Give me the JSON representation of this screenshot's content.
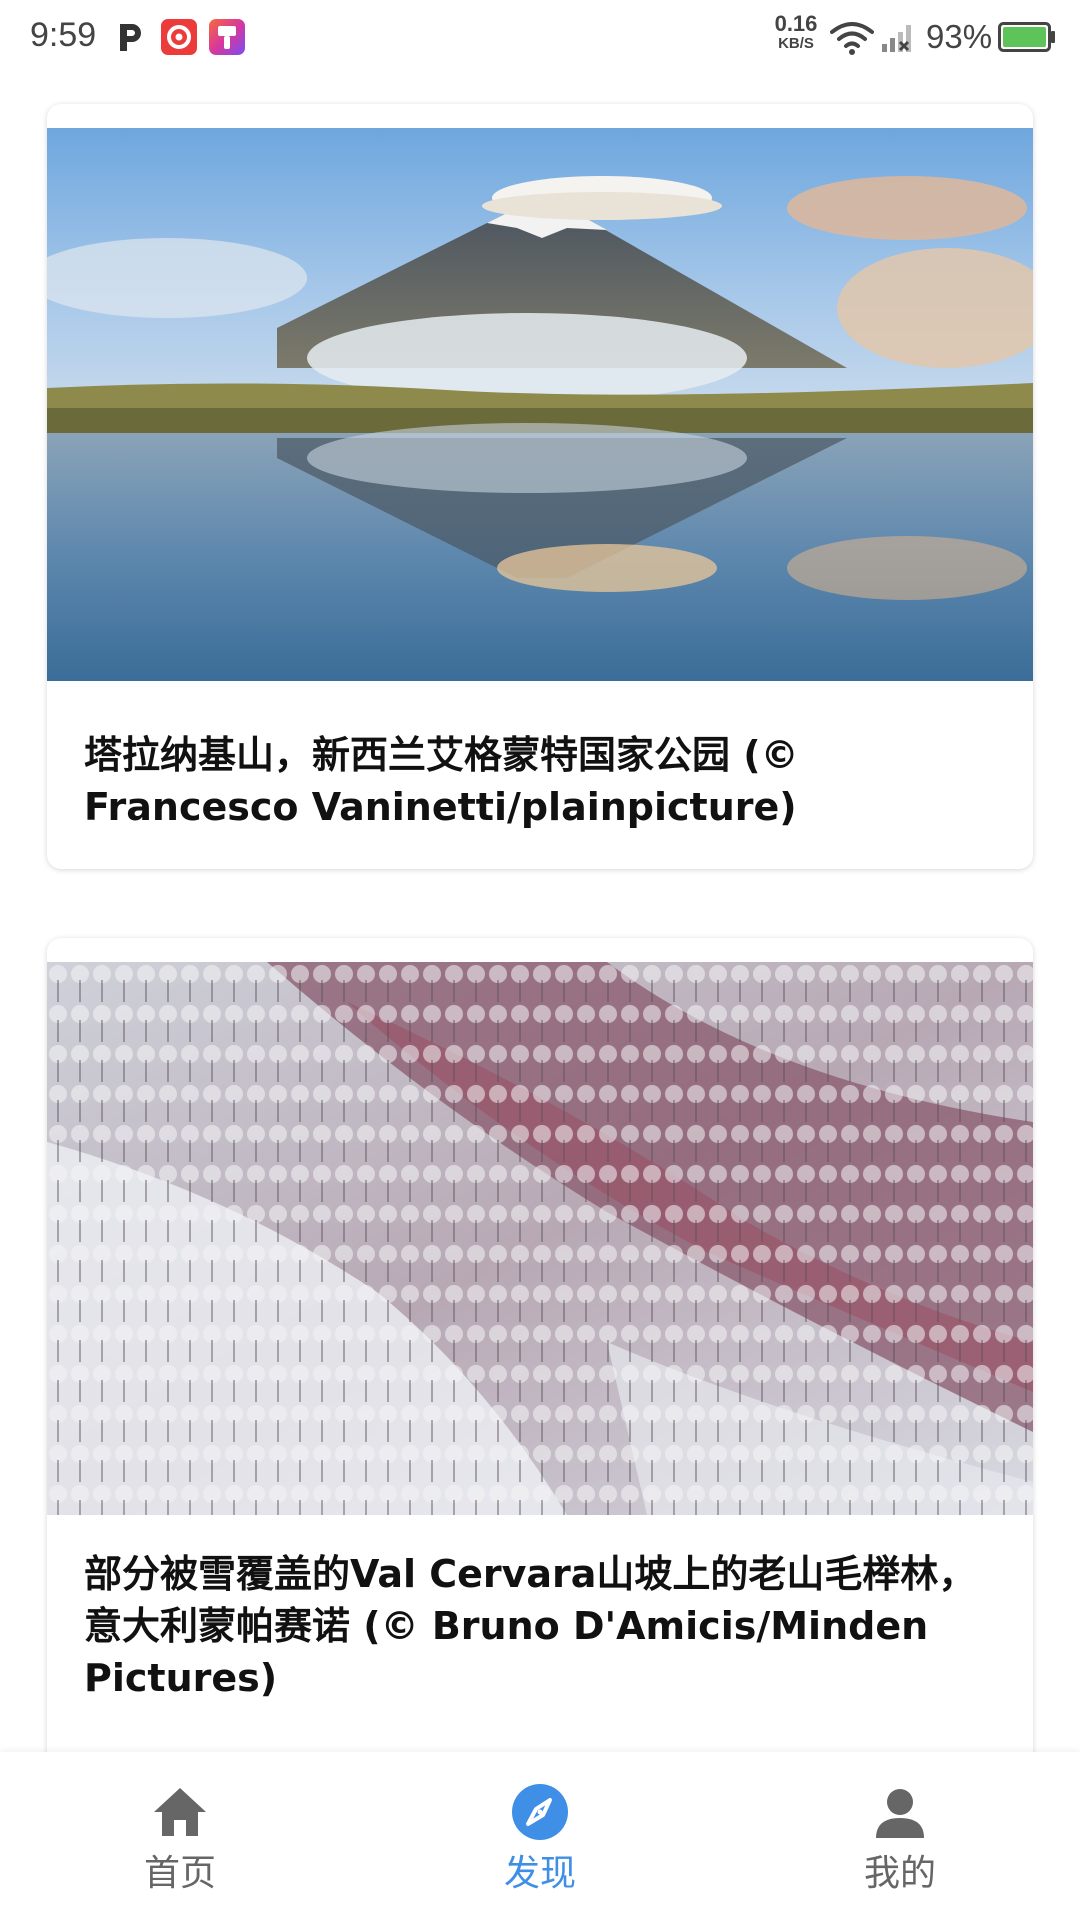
{
  "status_bar": {
    "time": "9:59",
    "net_speed_value": "0.16",
    "net_speed_unit": "KB/S",
    "battery_percent": "93%",
    "notification_icons": [
      "p-app-icon",
      "red-app-icon",
      "brush-app-icon"
    ]
  },
  "feed": {
    "cards": [
      {
        "caption": "塔拉纳基山，新西兰艾格蒙特国家公园 (© Francesco Vaninetti/plainpicture)",
        "image_icon": "mountain-lake-photo"
      },
      {
        "caption": "部分被雪覆盖的Val Cervara山坡上的老山毛榉林，意大利蒙帕赛诺 (© Bruno D'Amicis/Minden Pictures)",
        "image_icon": "frosted-forest-photo"
      }
    ]
  },
  "bottom_nav": {
    "items": [
      {
        "label": "首页",
        "icon": "home-icon",
        "active": false
      },
      {
        "label": "发现",
        "icon": "compass-icon",
        "active": true
      },
      {
        "label": "我的",
        "icon": "person-icon",
        "active": false
      }
    ],
    "active_color": "#3f8fe6",
    "inactive_color": "#666666"
  }
}
